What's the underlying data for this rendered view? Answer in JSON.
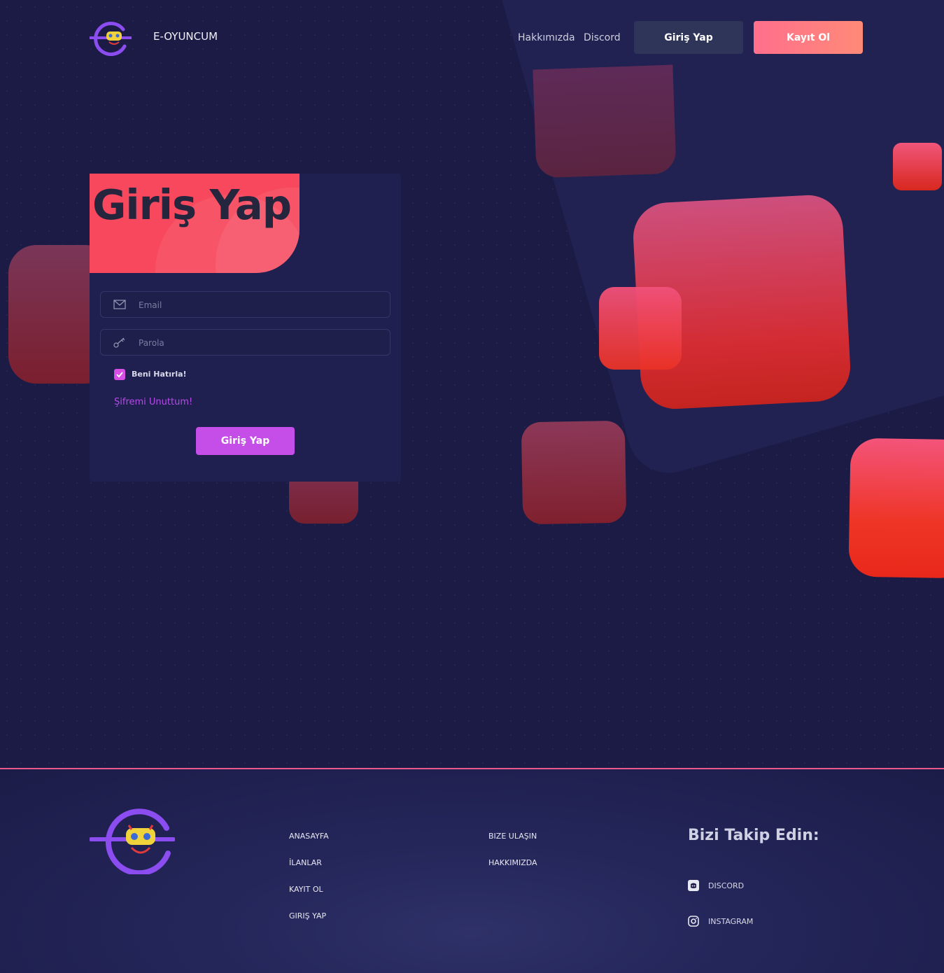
{
  "navbar": {
    "brand": "E-OYUNCUM",
    "links": [
      "Hakkımızda",
      "Discord"
    ],
    "login_button": "Giriş Yap",
    "register_button": "Kayıt Ol"
  },
  "login_card": {
    "title": "Giriş Yap",
    "email_placeholder": "Email",
    "password_placeholder": "Parola",
    "remember_label": "Beni Hatırla!",
    "remember_checked": true,
    "forgot_link": "Şifremi Unuttum!",
    "submit_label": "Giriş Yap"
  },
  "footer": {
    "col1": [
      "ANASAYFA",
      "İLANLAR",
      "KAYIT OL",
      "GIRIŞ YAP"
    ],
    "col2": [
      "BIZE ULAŞIN",
      "HAKKIMIZDA"
    ],
    "follow_title": "Bizi Takip Edin:",
    "social": [
      {
        "label": "DISCORD",
        "icon": "discord-icon"
      },
      {
        "label": "INSTAGRAM",
        "icon": "instagram-icon"
      }
    ]
  },
  "colors": {
    "background": "#1b1b45",
    "accent_pink": "#f7485d",
    "accent_purple": "#c64ee8",
    "footer_border": "#e85a8b"
  }
}
